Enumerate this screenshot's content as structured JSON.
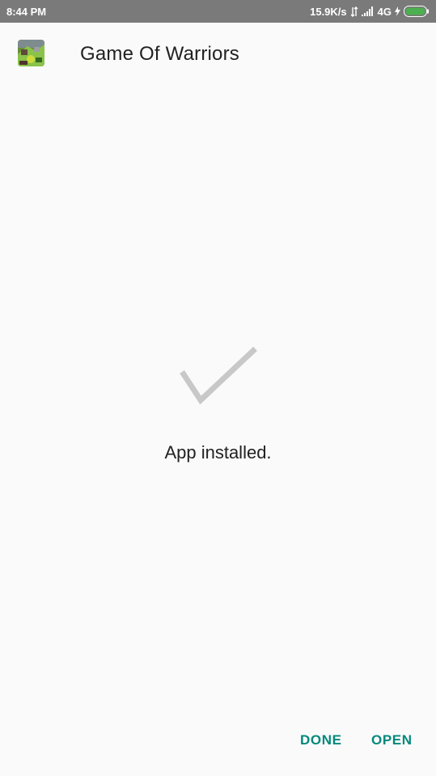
{
  "status_bar": {
    "time": "8:44 PM",
    "net_speed": "15.9K/s",
    "network_type": "4G",
    "icons": [
      "data-arrows-icon",
      "signal-icon",
      "charging-bolt-icon",
      "battery-icon"
    ],
    "battery_color": "#4caf50"
  },
  "header": {
    "app_name": "Game Of Warriors",
    "app_icon": "game-app-icon"
  },
  "main": {
    "icon": "checkmark-icon",
    "message": "App installed."
  },
  "actions": {
    "done_label": "DONE",
    "open_label": "OPEN"
  },
  "colors": {
    "accent": "#00897b",
    "status_bar_bg": "#7a7a7a",
    "background": "#fafafa",
    "check": "#c8c8c8"
  }
}
